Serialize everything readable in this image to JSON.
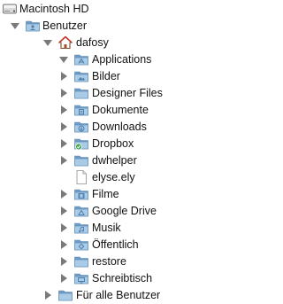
{
  "tree": {
    "items": [
      {
        "label": "Macintosh HD",
        "icon": "hard-drive-icon",
        "expanded": null
      },
      {
        "label": "Benutzer",
        "icon": "users-folder-icon",
        "expanded": true
      },
      {
        "label": "dafosy",
        "icon": "home-icon",
        "expanded": true
      },
      {
        "label": "Applications",
        "icon": "applications-folder-icon",
        "expanded": true
      },
      {
        "label": "Bilder",
        "icon": "pictures-folder-icon",
        "expanded": false
      },
      {
        "label": "Designer Files",
        "icon": "folder-icon",
        "expanded": false
      },
      {
        "label": "Dokumente",
        "icon": "documents-folder-icon",
        "expanded": false
      },
      {
        "label": "Downloads",
        "icon": "downloads-folder-icon",
        "expanded": false
      },
      {
        "label": "Dropbox",
        "icon": "dropbox-folder-icon",
        "expanded": false
      },
      {
        "label": "dwhelper",
        "icon": "folder-icon",
        "expanded": false
      },
      {
        "label": "elyse.ely",
        "icon": "document-file-icon",
        "expanded": null
      },
      {
        "label": "Filme",
        "icon": "movies-folder-icon",
        "expanded": false
      },
      {
        "label": "Google Drive",
        "icon": "google-drive-folder-icon",
        "expanded": false
      },
      {
        "label": "Musik",
        "icon": "music-folder-icon",
        "expanded": false
      },
      {
        "label": "Öffentlich",
        "icon": "public-folder-icon",
        "expanded": false
      },
      {
        "label": "restore",
        "icon": "folder-icon",
        "expanded": false
      },
      {
        "label": "Schreibtisch",
        "icon": "desktop-folder-icon",
        "expanded": false
      },
      {
        "label": "Für alle Benutzer",
        "icon": "shared-folder-icon",
        "expanded": false
      }
    ]
  },
  "colors": {
    "folder_light": "#a9cbe6",
    "folder_dark": "#6f9cc6",
    "folder_stroke": "#5a87b3",
    "disclosure": "#7a7a7a",
    "dropbox_badge": "#3fa64a"
  }
}
